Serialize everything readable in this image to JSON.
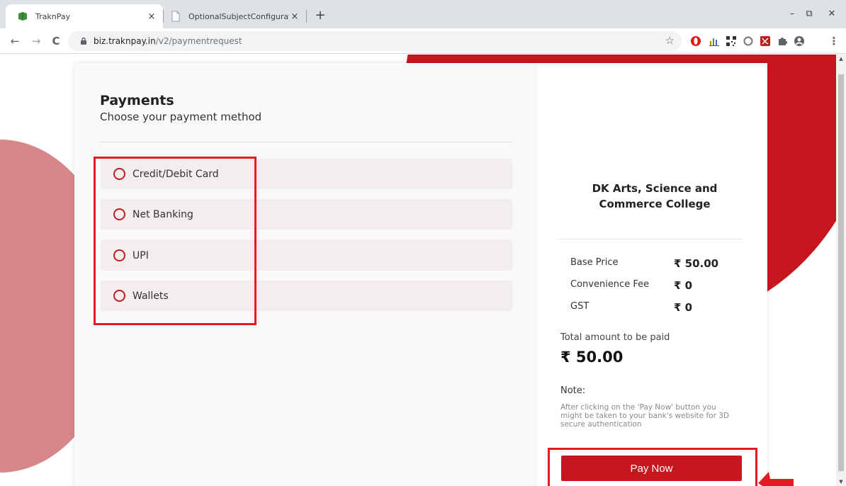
{
  "browser": {
    "tabs": [
      {
        "title": "TraknPay",
        "active": true
      },
      {
        "title": "OptionalSubjectConfiguration",
        "active": false
      }
    ],
    "tab_close_glyph": "×",
    "new_tab_glyph": "+",
    "window_controls": {
      "minimize": "–",
      "restore": "⧉",
      "close": "✕"
    },
    "nav": {
      "back": "←",
      "forward": "→",
      "reload": "C"
    },
    "url_host": "biz.traknpay.in",
    "url_path": "/v2/paymentrequest",
    "bookmark_glyph": "☆",
    "extensions": [
      "opera-icon",
      "chart-icon",
      "qr-icon",
      "circle-icon",
      "pdf-icon",
      "puzzle-icon",
      "profile-icon",
      "menu-icon"
    ],
    "menu_glyph": "⋮"
  },
  "colors": {
    "brand_red": "#c5171d",
    "highlight_red": "#e21c22",
    "blob_pink": "#d6878a"
  },
  "payments": {
    "title": "Payments",
    "subtitle": "Choose your payment method",
    "options": [
      {
        "label": "Credit/Debit Card"
      },
      {
        "label": "Net Banking"
      },
      {
        "label": "UPI"
      },
      {
        "label": "Wallets"
      }
    ]
  },
  "summary": {
    "college": "DK Arts, Science and Commerce College",
    "rows": [
      {
        "label": "Base Price",
        "value": "₹ 50.00"
      },
      {
        "label": "Convenience Fee",
        "value": "₹ 0"
      },
      {
        "label": "GST",
        "value": "₹ 0"
      }
    ],
    "total_label": "Total amount to be paid",
    "total_value": "₹ 50.00",
    "note_label": "Note:",
    "note_text": "After clicking on the 'Pay Now' button you might be taken to your bank's website for 3D secure authentication",
    "pay_button": "Pay Now"
  }
}
